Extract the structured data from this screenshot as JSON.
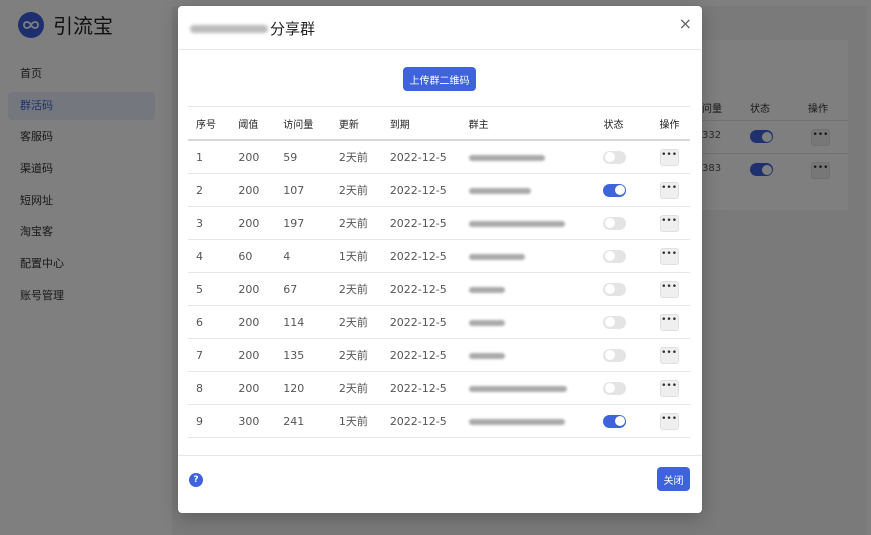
{
  "app": {
    "name": "引流宝"
  },
  "sidebar": {
    "items": [
      {
        "label": "首页",
        "active": false
      },
      {
        "label": "群活码",
        "active": true
      },
      {
        "label": "客服码",
        "active": false
      },
      {
        "label": "渠道码",
        "active": false
      },
      {
        "label": "短网址",
        "active": false
      },
      {
        "label": "淘宝客",
        "active": false
      },
      {
        "label": "配置中心",
        "active": false
      },
      {
        "label": "账号管理",
        "active": false
      }
    ]
  },
  "background_table": {
    "headers": {
      "visits": "问量",
      "status": "状态",
      "actions": "操作"
    },
    "rows": [
      {
        "visits": "332",
        "status": "on"
      },
      {
        "visits": "383",
        "status": "on"
      }
    ]
  },
  "modal": {
    "title_suffix": "分享群",
    "close_icon": "×",
    "upload_button": "上传群二维码",
    "close_button": "关闭",
    "help_icon": "?",
    "columns": [
      "序号",
      "阈值",
      "访问量",
      "更新",
      "到期",
      "群主",
      "状态",
      "操作"
    ],
    "rows": [
      {
        "no": "1",
        "threshold": "200",
        "visits": "59",
        "updated": "2天前",
        "expires": "2022-12-5",
        "status": "off"
      },
      {
        "no": "2",
        "threshold": "200",
        "visits": "107",
        "updated": "2天前",
        "expires": "2022-12-5",
        "status": "on"
      },
      {
        "no": "3",
        "threshold": "200",
        "visits": "197",
        "updated": "2天前",
        "expires": "2022-12-5",
        "status": "off"
      },
      {
        "no": "4",
        "threshold": "60",
        "visits": "4",
        "updated": "1天前",
        "expires": "2022-12-5",
        "status": "off"
      },
      {
        "no": "5",
        "threshold": "200",
        "visits": "67",
        "updated": "2天前",
        "expires": "2022-12-5",
        "status": "off"
      },
      {
        "no": "6",
        "threshold": "200",
        "visits": "114",
        "updated": "2天前",
        "expires": "2022-12-5",
        "status": "off"
      },
      {
        "no": "7",
        "threshold": "200",
        "visits": "135",
        "updated": "2天前",
        "expires": "2022-12-5",
        "status": "off"
      },
      {
        "no": "8",
        "threshold": "200",
        "visits": "120",
        "updated": "2天前",
        "expires": "2022-12-5",
        "status": "off"
      },
      {
        "no": "9",
        "threshold": "300",
        "visits": "241",
        "updated": "1天前",
        "expires": "2022-12-5",
        "status": "on"
      }
    ],
    "more_icon": "•••"
  },
  "colors": {
    "accent": "#3e63dd",
    "toggle_off": "#e4e4e4",
    "overlay": "rgba(0,0,0,0.5)"
  }
}
